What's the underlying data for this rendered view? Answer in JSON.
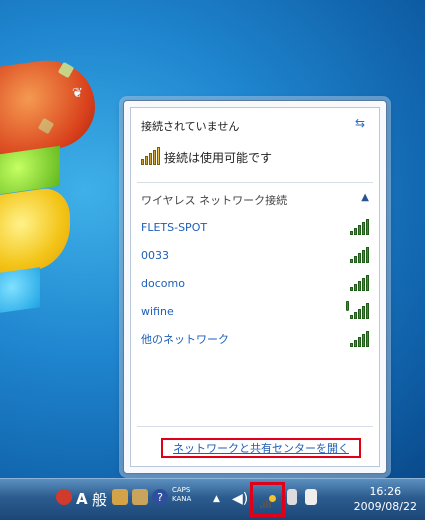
{
  "popup": {
    "not_connected": "接続されていません",
    "available": "接続は使用可能です",
    "section_title": "ワイヤレス ネットワーク接続",
    "networks": [
      {
        "name": "FLETS-SPOT",
        "secured": false
      },
      {
        "name": "0033",
        "secured": false
      },
      {
        "name": "docomo",
        "secured": false
      },
      {
        "name": "wifine",
        "secured": true
      },
      {
        "name": "他のネットワーク",
        "secured": false
      }
    ],
    "footer_link": "ネットワークと共有センターを開く"
  },
  "taskbar": {
    "ime_mode": "A",
    "ime_kanji": "般",
    "caps": "CAPS",
    "kana": "KANA",
    "time": "16:26",
    "date": "2009/08/22"
  },
  "colors": {
    "link": "#1d5fb8",
    "highlight": "#e0001a",
    "signal": "#3d8f2e"
  }
}
